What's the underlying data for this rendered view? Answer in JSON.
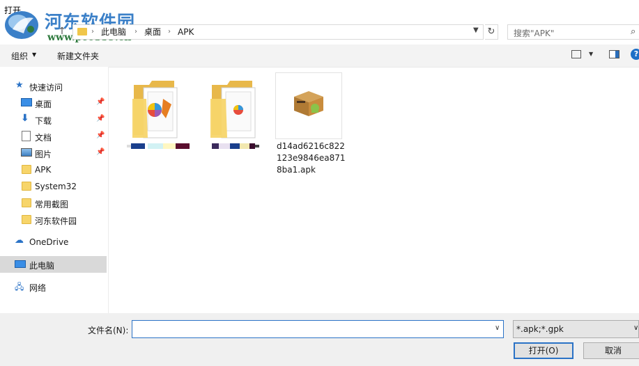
{
  "window": {
    "title": "打开"
  },
  "watermark": {
    "name": "河东软件园",
    "url": "www.pc0359.cn"
  },
  "address": {
    "crumbs": [
      "此电脑",
      "桌面",
      "APK"
    ],
    "search_placeholder": "搜索\"APK\""
  },
  "toolbar": {
    "organize_label": "组织",
    "new_folder_label": "新建文件夹"
  },
  "sidebar": {
    "quick_access": "快速访问",
    "items": [
      {
        "label": "桌面",
        "pinned": true
      },
      {
        "label": "下载",
        "pinned": true
      },
      {
        "label": "文档",
        "pinned": true
      },
      {
        "label": "图片",
        "pinned": true
      },
      {
        "label": "APK",
        "pinned": false
      },
      {
        "label": "System32",
        "pinned": false
      },
      {
        "label": "常用截图",
        "pinned": false
      },
      {
        "label": "河东软件园",
        "pinned": false
      }
    ],
    "onedrive": "OneDrive",
    "this_pc": "此电脑",
    "network": "网络"
  },
  "files": [
    {
      "name": "",
      "type": "folder",
      "note": "name redacted"
    },
    {
      "name": "",
      "type": "folder",
      "note": "name redacted"
    },
    {
      "name": "d14ad6216c822123e9846ea8718ba1.apk",
      "type": "apk",
      "lines": [
        "d14ad6216c822",
        "123e9846ea871",
        "8ba1.apk"
      ]
    }
  ],
  "bottom": {
    "filename_label": "文件名(N):",
    "filename_value": "",
    "filetype_value": "*.apk;*.gpk",
    "open_label": "打开(O)",
    "cancel_label": "取消"
  },
  "colors": {
    "accent": "#2a72c6",
    "selected_bg": "#d9d9d9",
    "folder": "#f7d56a"
  }
}
